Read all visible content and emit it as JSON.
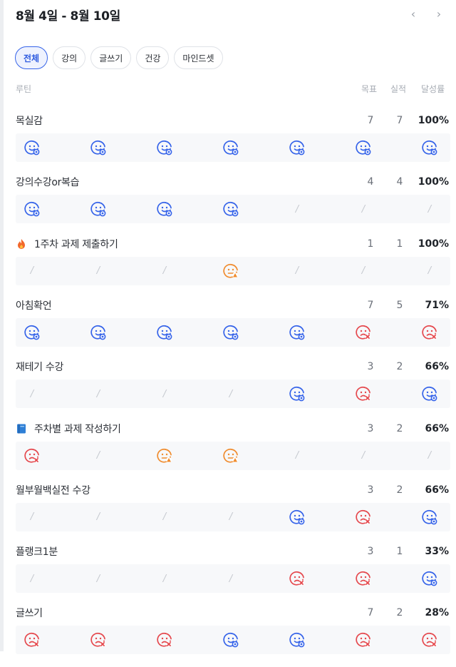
{
  "header": {
    "title": "8월 4일 - 8월 10일",
    "prev_icon": "‹",
    "next_icon": "›"
  },
  "tabs": [
    {
      "label": "전체",
      "active": true
    },
    {
      "label": "강의",
      "active": false
    },
    {
      "label": "글쓰기",
      "active": false
    },
    {
      "label": "건강",
      "active": false
    },
    {
      "label": "마인드셋",
      "active": false
    }
  ],
  "columns": {
    "routine": "루틴",
    "goal": "목표",
    "actual": "실적",
    "rate": "달성률"
  },
  "colors": {
    "done": "#3563e9",
    "missed": "#e5484d",
    "pending": "#f08c2e",
    "empty": "#c5c9cf"
  },
  "routines": [
    {
      "name": "목실감",
      "icon": "",
      "goal": "7",
      "actual": "7",
      "rate": "100%",
      "days": [
        "done",
        "done",
        "done",
        "done",
        "done",
        "done",
        "done"
      ]
    },
    {
      "name": "강의수강or복습",
      "icon": "",
      "goal": "4",
      "actual": "4",
      "rate": "100%",
      "days": [
        "done",
        "done",
        "done",
        "done",
        "empty",
        "empty",
        "empty"
      ]
    },
    {
      "name": "1주차 과제 제출하기",
      "icon": "fire-icon",
      "goal": "1",
      "actual": "1",
      "rate": "100%",
      "days": [
        "empty",
        "empty",
        "empty",
        "pending",
        "empty",
        "empty",
        "empty"
      ]
    },
    {
      "name": "아침확언",
      "icon": "",
      "goal": "7",
      "actual": "5",
      "rate": "71%",
      "days": [
        "done",
        "done",
        "done",
        "done",
        "done",
        "missed",
        "missed"
      ]
    },
    {
      "name": "재테기 수강",
      "icon": "",
      "goal": "3",
      "actual": "2",
      "rate": "66%",
      "days": [
        "empty",
        "empty",
        "empty",
        "empty",
        "done",
        "missed",
        "done"
      ]
    },
    {
      "name": "주차별 과제 작성하기",
      "icon": "book-icon",
      "goal": "3",
      "actual": "2",
      "rate": "66%",
      "days": [
        "missed",
        "empty",
        "pending",
        "pending",
        "empty",
        "empty",
        "empty"
      ]
    },
    {
      "name": "월부월백실전 수강",
      "icon": "",
      "goal": "3",
      "actual": "2",
      "rate": "66%",
      "days": [
        "empty",
        "empty",
        "empty",
        "empty",
        "done",
        "missed",
        "done"
      ]
    },
    {
      "name": "플랭크1분",
      "icon": "",
      "goal": "3",
      "actual": "1",
      "rate": "33%",
      "days": [
        "empty",
        "empty",
        "empty",
        "empty",
        "missed",
        "missed",
        "done"
      ]
    },
    {
      "name": "글쓰기",
      "icon": "",
      "goal": "7",
      "actual": "2",
      "rate": "28%",
      "days": [
        "missed",
        "missed",
        "missed",
        "done",
        "done",
        "missed",
        "missed"
      ]
    }
  ]
}
